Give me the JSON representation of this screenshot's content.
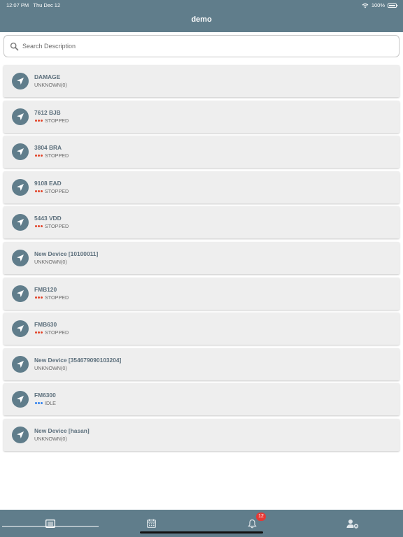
{
  "status_bar": {
    "time": "12:07 PM",
    "date": "Thu Dec 12",
    "battery": "100%"
  },
  "header": {
    "title": "demo"
  },
  "search": {
    "placeholder": "Search Description",
    "value": ""
  },
  "colors": {
    "header": "#607d8b",
    "stopped": "#e2452a",
    "idle": "#2f80ed"
  },
  "devices": [
    {
      "name": "DAMAGE",
      "status": "UNKNOWN(0)",
      "indicator": "none"
    },
    {
      "name": "7612 BJB",
      "status": "STOPPED",
      "indicator": "red"
    },
    {
      "name": "3804 BRA",
      "status": "STOPPED",
      "indicator": "red"
    },
    {
      "name": "9108 EAD",
      "status": "STOPPED",
      "indicator": "red"
    },
    {
      "name": "5443 VDD",
      "status": "STOPPED",
      "indicator": "red"
    },
    {
      "name": "New Device [10100011]",
      "status": "UNKNOWN(0)",
      "indicator": "none"
    },
    {
      "name": "FMB120",
      "status": "STOPPED",
      "indicator": "red"
    },
    {
      "name": "FMB630",
      "status": "STOPPED",
      "indicator": "red"
    },
    {
      "name": "New Device [354679090103204]",
      "status": "UNKNOWN(0)",
      "indicator": "none"
    },
    {
      "name": "FM6300",
      "status": "IDLE",
      "indicator": "blue"
    },
    {
      "name": "New Device [hasan]",
      "status": "UNKNOWN(0)",
      "indicator": "none"
    }
  ],
  "tabbar": {
    "tabs": [
      {
        "icon": "list-icon",
        "active": true
      },
      {
        "icon": "calendar-icon",
        "active": false
      },
      {
        "icon": "bell-icon",
        "active": false,
        "badge": "12"
      },
      {
        "icon": "user-settings-icon",
        "active": false
      }
    ]
  }
}
